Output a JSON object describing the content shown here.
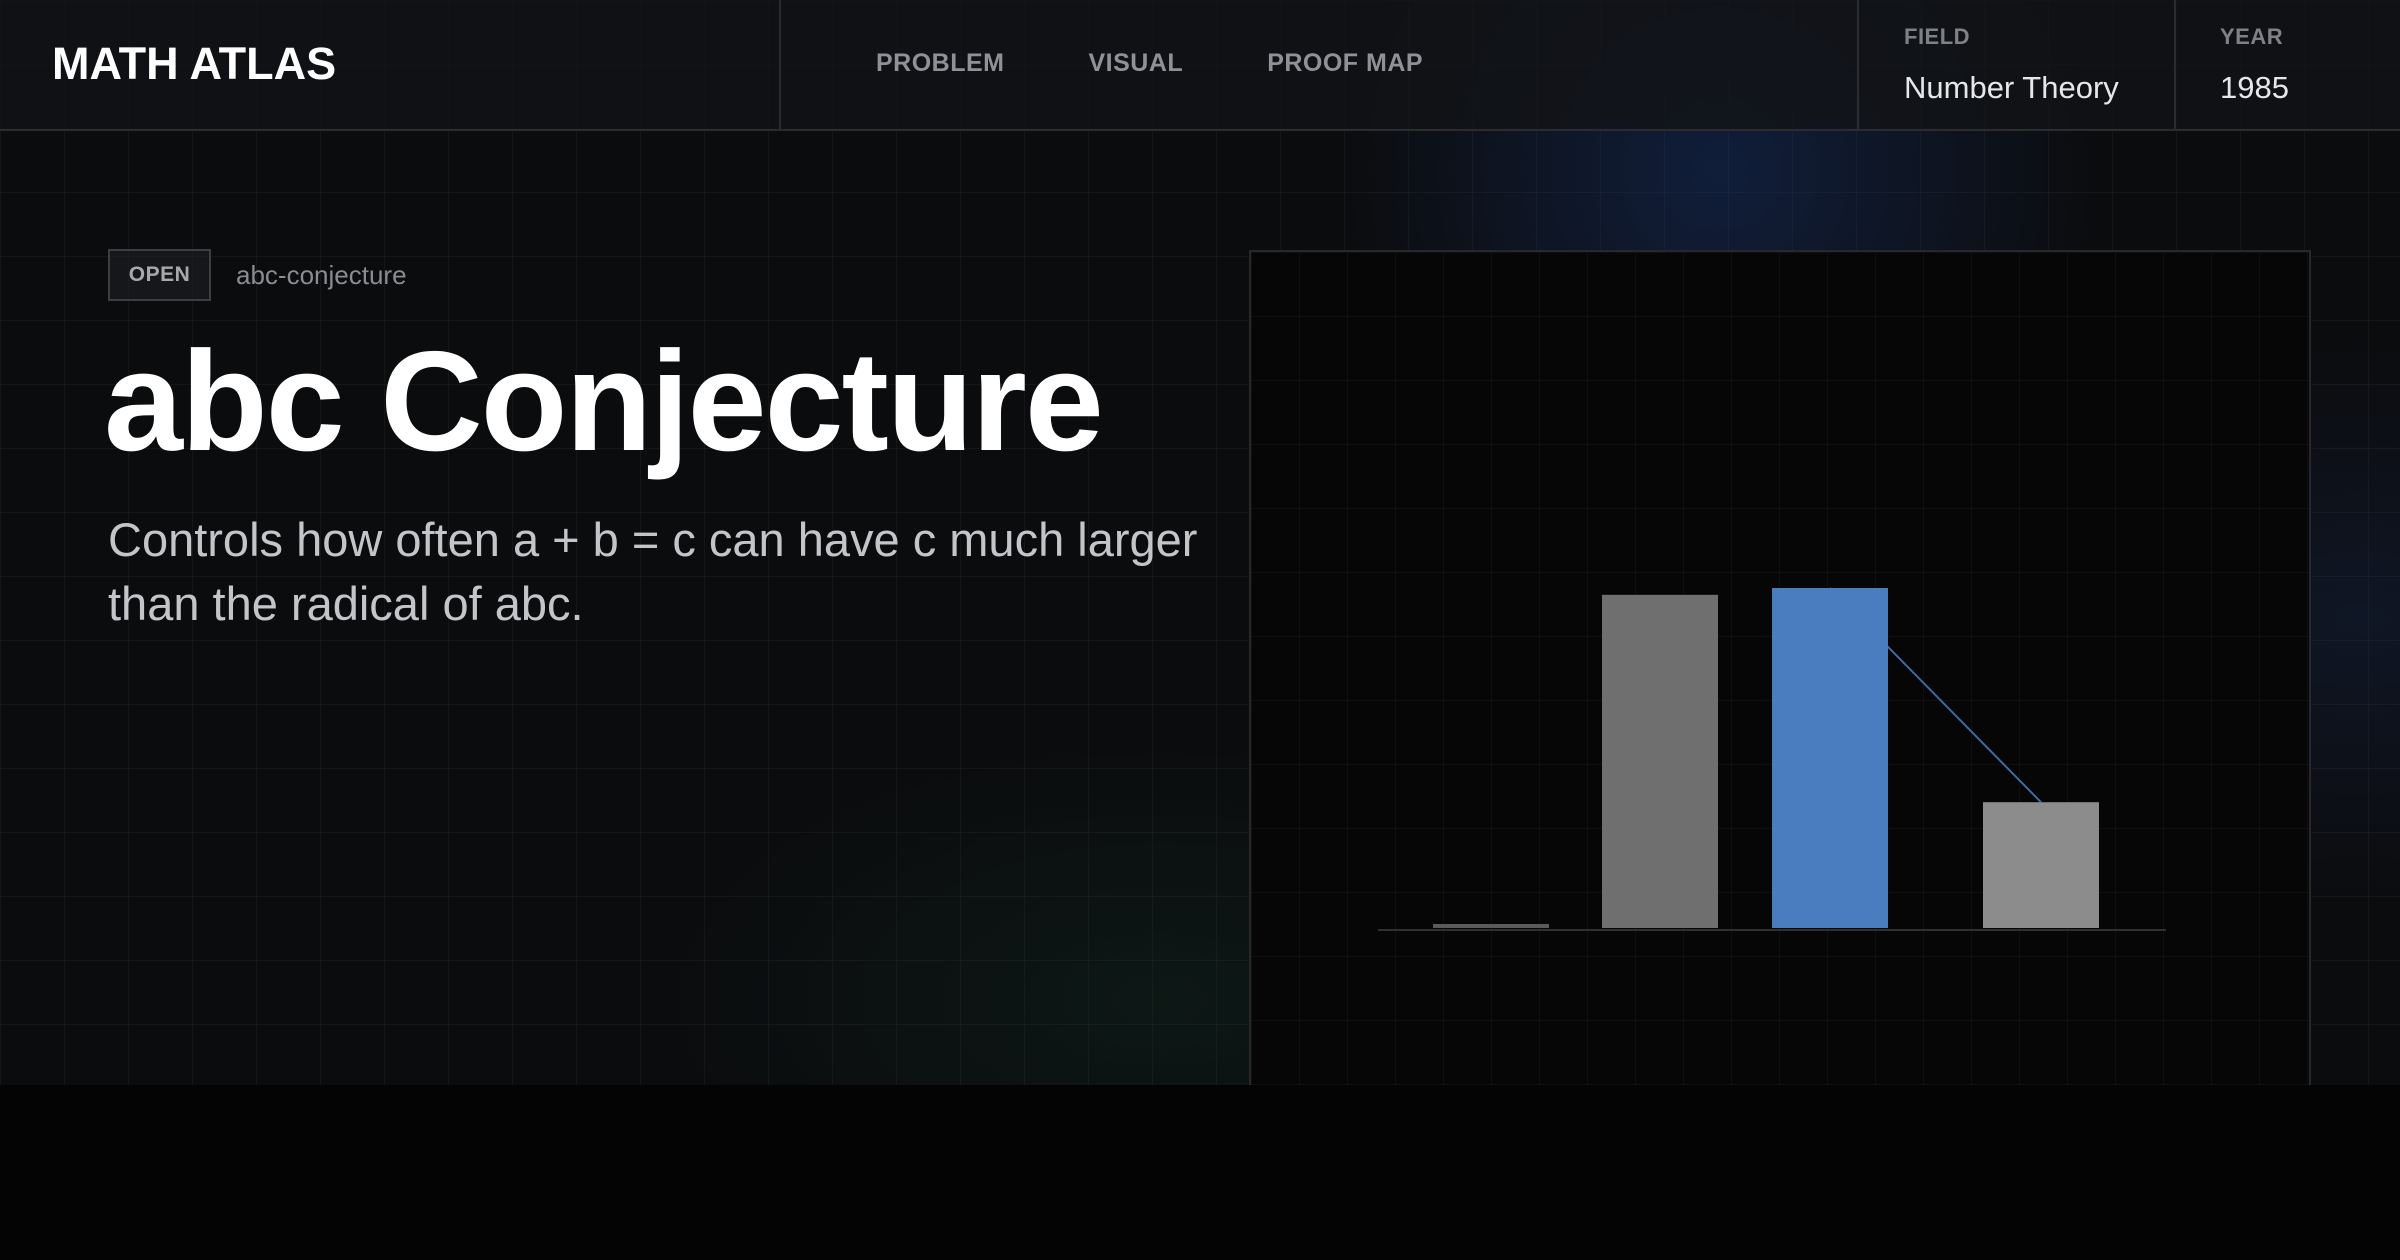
{
  "header": {
    "brand": "MATH ATLAS",
    "nav": [
      {
        "label": "PROBLEM"
      },
      {
        "label": "VISUAL"
      },
      {
        "label": "PROOF MAP"
      }
    ],
    "field": {
      "label": "FIELD",
      "value": "Number Theory"
    },
    "year": {
      "label": "YEAR",
      "value": "1985"
    }
  },
  "hero": {
    "status": "OPEN",
    "slug": "abc-conjecture",
    "title": "abc Conjecture",
    "description": "Controls how often a + b = c can have c much larger than the radical of abc."
  },
  "chart_data": {
    "type": "bar",
    "categories": [
      "",
      "",
      "",
      ""
    ],
    "values": [
      1,
      98,
      100,
      37
    ],
    "colors": [
      "#5a5a5a",
      "#6f6f6f",
      "#4a7cc0",
      "#8c8c8c"
    ],
    "highlight_index": 2,
    "connector": {
      "from": 2,
      "to": 3,
      "color": "#4a7cc0"
    },
    "ylim": [
      0,
      100
    ],
    "grid": true,
    "title": "",
    "xlabel": "",
    "ylabel": ""
  }
}
